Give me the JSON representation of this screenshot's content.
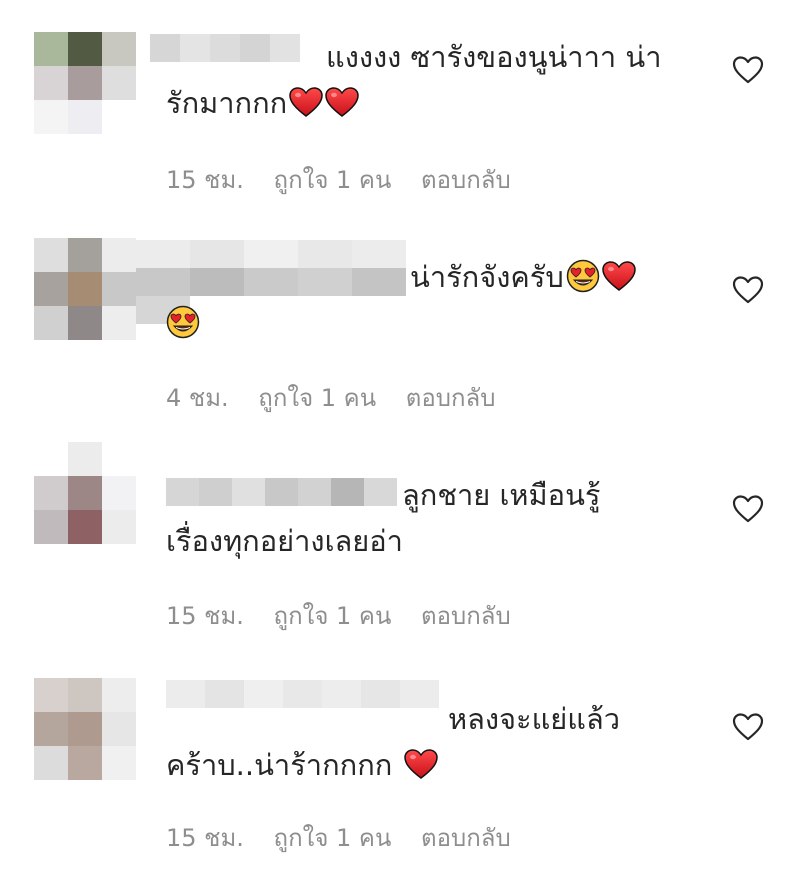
{
  "colors": {
    "text": "#262626",
    "meta": "#8e8e8e",
    "heart_fill": "#e8202a",
    "emoji_face": "#ffc83d"
  },
  "comments": [
    {
      "line1": "แงงงง ซารังของนูน่าาา น่า",
      "line2": "รักมากกก",
      "time": "15 ชม.",
      "likes": "ถูกใจ 1 คน",
      "reply": "ตอบกลับ",
      "emojis": [
        "heart-emoji",
        "heart-emoji"
      ],
      "avatar_colors": [
        "#a9b79a",
        "#525a43",
        "#c8c8c0",
        "#d8d4d6",
        "#a89c9c",
        "#dedede",
        "#f4f4f4",
        "#eeeef2",
        "#ffffff"
      ],
      "username_colors": [
        "#d6d6d6",
        "#e4e4e4",
        "#dcdcdc",
        "#d4d4d4",
        "#e2e2e2"
      ]
    },
    {
      "line1": "น่ารักจังครับ",
      "line2": "",
      "time": "4 ชม.",
      "likes": "ถูกใจ 1 คน",
      "reply": "ตอบกลับ",
      "emojis": [
        "heart-eyes-emoji",
        "heart-emoji",
        "heart-eyes-emoji"
      ],
      "avatar_colors": [
        "#dedede",
        "#a4a09c",
        "#ececec",
        "#a8a29e",
        "#a58c72",
        "#c8c8c8",
        "#d0d0d0",
        "#8e8888",
        "#ededed"
      ],
      "username_colors": [
        "#ececec",
        "#e6e6e6",
        "#f0f0f0",
        "#e8e8e8",
        "#ececec",
        "#c8c8c8",
        "#bcbcbc",
        "#cacaca",
        "#d0d0d0",
        "#c4c4c4",
        "#d6d6d6"
      ]
    },
    {
      "line1": "ลูกชาย เหมือนรู้",
      "line2": "เรื่องทุกอย่างเลยอ่า",
      "time": "15 ชม.",
      "likes": "ถูกใจ 1 คน",
      "reply": "ตอบกลับ",
      "emojis": [],
      "avatar_colors": [
        "#ffffff",
        "#ececec",
        "#ffffff",
        "#d0cccd",
        "#9c8686",
        "#f2f2f4",
        "#c0babc",
        "#8e6264",
        "#ececec"
      ],
      "username_colors": [
        "#d6d6d6",
        "#cfcfcf",
        "#e0e0e0",
        "#c8c8c8",
        "#d2d2d2",
        "#b6b6b6",
        "#d8d8d8"
      ]
    },
    {
      "line1": "หลงจะแย่แล้ว",
      "line2": "คร้าบ..น่าร้ากกกก",
      "time": "15 ชม.",
      "likes": "ถูกใจ 1 คน",
      "reply": "ตอบกลับ",
      "emojis": [
        "heart-emoji"
      ],
      "avatar_colors": [
        "#d8d0cc",
        "#cec6c0",
        "#ededed",
        "#b4a69c",
        "#ae9a8e",
        "#e6e6e6",
        "#dcdcdc",
        "#b8a8a0",
        "#f0f0f0"
      ],
      "username_colors": [
        "#ececec",
        "#e4e4e4",
        "#efefef",
        "#e8e8e8",
        "#ededed",
        "#e6e6e6",
        "#ececec"
      ]
    }
  ]
}
